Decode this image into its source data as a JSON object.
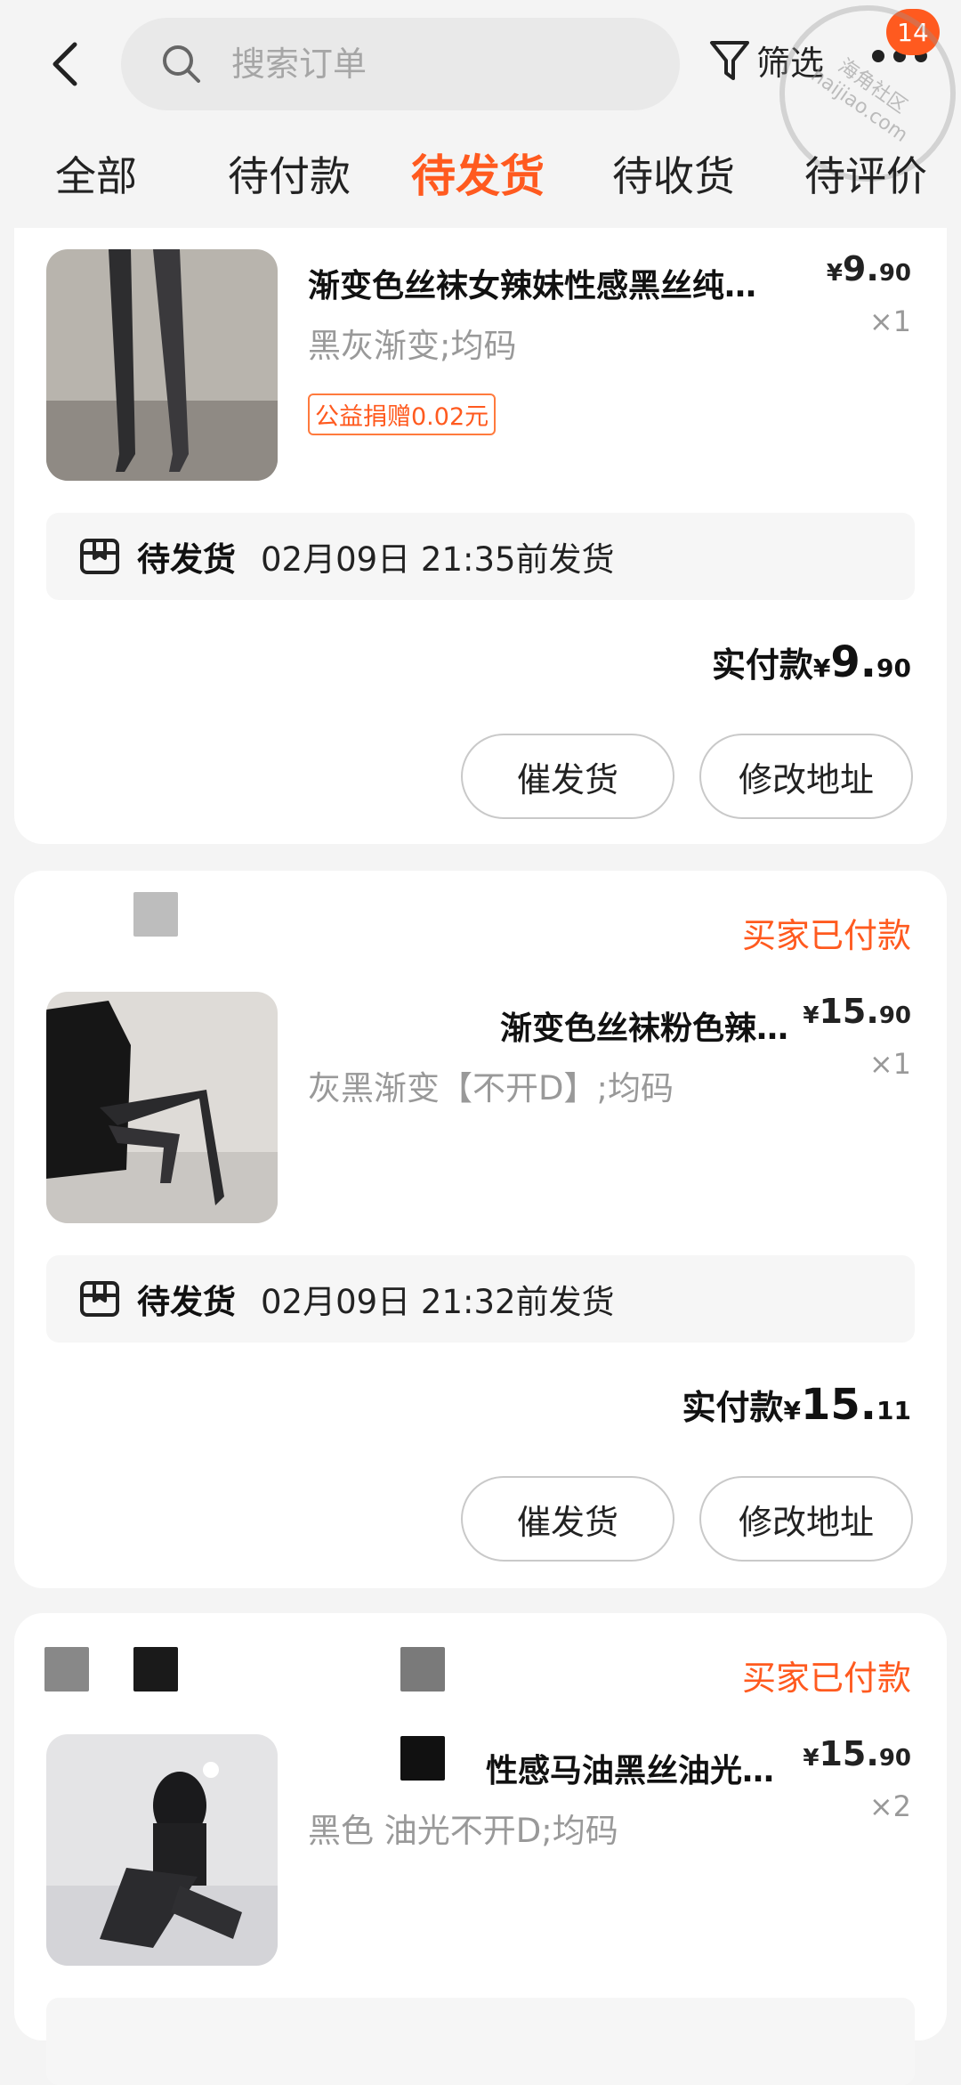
{
  "header": {
    "search_placeholder": "搜索订单",
    "filter_label": "筛选",
    "badge_count": "14",
    "watermark_line1": "海角社区",
    "watermark_line2": "haijiao.com"
  },
  "tabs": [
    {
      "label": "全部"
    },
    {
      "label": "待付款"
    },
    {
      "label": "待发货",
      "active": true
    },
    {
      "label": "待收货"
    },
    {
      "label": "待评价"
    }
  ],
  "orders": [
    {
      "title": "渐变色丝袜女辣妹性感黑丝纯…",
      "spec": "黑灰渐变;均码",
      "tag": "公益捐赠0.02元",
      "price_currency": "¥",
      "price_int": "9.",
      "price_dec": "90",
      "qty": "×1",
      "ship_status": "待发货",
      "ship_time": "02月09日 21:35前发货",
      "paid_label": "实付款",
      "paid_currency": "¥",
      "paid_int": "9.",
      "paid_dec": "90",
      "btn_urge": "催发货",
      "btn_address": "修改地址"
    },
    {
      "status": "买家已付款",
      "title": "渐变色丝袜粉色辣…",
      "spec": "灰黑渐变【不开D】;均码",
      "price_currency": "¥",
      "price_int": "15.",
      "price_dec": "90",
      "qty": "×1",
      "ship_status": "待发货",
      "ship_time": "02月09日 21:32前发货",
      "paid_label": "实付款",
      "paid_currency": "¥",
      "paid_int": "15.",
      "paid_dec": "11",
      "btn_urge": "催发货",
      "btn_address": "修改地址"
    },
    {
      "status": "买家已付款",
      "title": "性感马油黑丝油光…",
      "spec": "黑色 油光不开D;均码",
      "price_currency": "¥",
      "price_int": "15.",
      "price_dec": "90",
      "qty": "×2"
    }
  ],
  "colors": {
    "accent": "#ff5a1f",
    "background": "#f4f4f4",
    "card": "#ffffff"
  }
}
